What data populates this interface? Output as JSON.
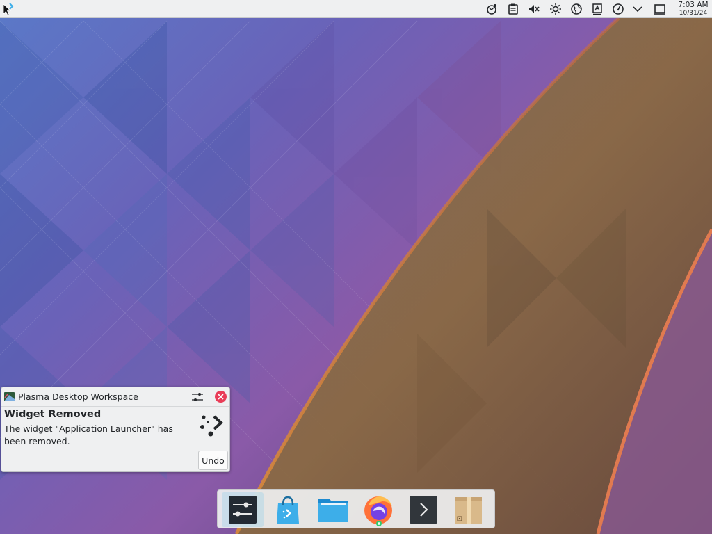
{
  "top_panel": {
    "clock": {
      "time": "7:03 AM",
      "date": "10/31/24"
    },
    "tray_icons": [
      "network-icon",
      "clipboard-icon",
      "volume-muted-icon",
      "brightness-icon",
      "globe-icon",
      "keyboard-layout-icon",
      "speedometer-icon",
      "tray-expand-icon",
      "show-desktop-icon"
    ]
  },
  "notification": {
    "app_name": "Plasma Desktop Workspace",
    "title": "Widget Removed",
    "body": "The widget \"Application Launcher\" has been removed.",
    "action_label": "Undo"
  },
  "dock": {
    "items": [
      {
        "icon": "system-settings-icon",
        "active": true
      },
      {
        "icon": "discover-store-icon",
        "active": false
      },
      {
        "icon": "dolphin-folder-icon",
        "active": false
      },
      {
        "icon": "firefox-icon",
        "active": false
      },
      {
        "icon": "konsole-terminal-icon",
        "active": false
      },
      {
        "icon": "ark-archive-icon",
        "active": false
      }
    ]
  },
  "colors": {
    "panel_bg": "#eff0f1",
    "close_red": "#e93d58",
    "accent_blue": "#3daee9"
  }
}
